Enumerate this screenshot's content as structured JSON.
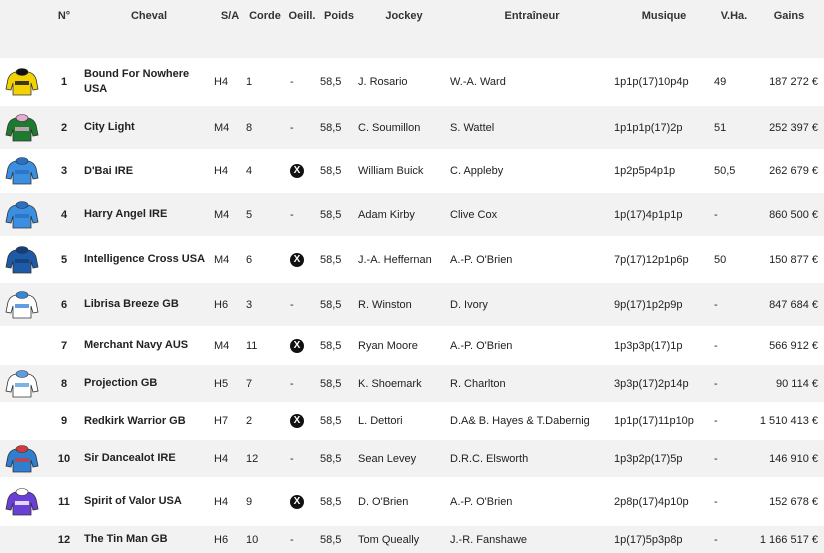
{
  "headers": {
    "num": "N°",
    "horse": "Cheval",
    "sa": "S/A",
    "corde": "Corde",
    "oeil": "Oeill.",
    "poids": "Poids",
    "jockey": "Jockey",
    "trainer": "Entraîneur",
    "musique": "Musique",
    "vha": "V.Ha.",
    "gains": "Gains"
  },
  "rows": [
    {
      "num": "1",
      "horse": "Bound For Nowhere USA",
      "sa": "H4",
      "corde": "1",
      "oeil": "-",
      "poids": "58,5",
      "jockey": "J. Rosario",
      "trainer": "W.-A. Ward",
      "musique": "1p1p(17)10p4p",
      "vha": "49",
      "gains": "187 272 €",
      "silk": "bound"
    },
    {
      "num": "2",
      "horse": "City Light",
      "sa": "M4",
      "corde": "8",
      "oeil": "-",
      "poids": "58,5",
      "jockey": "C. Soumillon",
      "trainer": "S. Wattel",
      "musique": "1p1p1p(17)2p",
      "vha": "51",
      "gains": "252 397 €",
      "silk": "city"
    },
    {
      "num": "3",
      "horse": "D'Bai IRE",
      "sa": "H4",
      "corde": "4",
      "oeil": "X",
      "poids": "58,5",
      "jockey": "William Buick",
      "trainer": "C. Appleby",
      "musique": "1p2p5p4p1p",
      "vha": "50,5",
      "gains": "262 679 €",
      "silk": "blue"
    },
    {
      "num": "4",
      "horse": "Harry Angel IRE",
      "sa": "M4",
      "corde": "5",
      "oeil": "-",
      "poids": "58,5",
      "jockey": "Adam Kirby",
      "trainer": "Clive Cox",
      "musique": "1p(17)4p1p1p",
      "vha": "-",
      "gains": "860 500 €",
      "silk": "blue"
    },
    {
      "num": "5",
      "horse": "Intelligence Cross USA",
      "sa": "M4",
      "corde": "6",
      "oeil": "X",
      "poids": "58,5",
      "jockey": "J.-A. Heffernan",
      "trainer": "A.-P. O'Brien",
      "musique": "7p(17)12p1p6p",
      "vha": "50",
      "gains": "150 877 €",
      "silk": "navy"
    },
    {
      "num": "6",
      "horse": "Librisa Breeze GB",
      "sa": "H6",
      "corde": "3",
      "oeil": "-",
      "poids": "58,5",
      "jockey": "R. Winston",
      "trainer": "D. Ivory",
      "musique": "9p(17)1p2p9p",
      "vha": "-",
      "gains": "847 684 €",
      "silk": "stripe"
    },
    {
      "num": "7",
      "horse": "Merchant Navy AUS",
      "sa": "M4",
      "corde": "11",
      "oeil": "X",
      "poids": "58,5",
      "jockey": "Ryan Moore",
      "trainer": "A.-P. O'Brien",
      "musique": "1p3p3p(17)1p",
      "vha": "-",
      "gains": "566 912 €",
      "silk": "none"
    },
    {
      "num": "8",
      "horse": "Projection GB",
      "sa": "H5",
      "corde": "7",
      "oeil": "-",
      "poids": "58,5",
      "jockey": "K. Shoemark",
      "trainer": "R. Charlton",
      "musique": "3p3p(17)2p14p",
      "vha": "-",
      "gains": "90 114 €",
      "silk": "white"
    },
    {
      "num": "9",
      "horse": "Redkirk Warrior GB",
      "sa": "H7",
      "corde": "2",
      "oeil": "X",
      "poids": "58,5",
      "jockey": "L. Dettori",
      "trainer": "D.A& B. Hayes & T.Dabernig",
      "musique": "1p1p(17)11p10p",
      "vha": "-",
      "gains": "1 510 413 €",
      "silk": "none"
    },
    {
      "num": "10",
      "horse": "Sir Dancealot IRE",
      "sa": "H4",
      "corde": "12",
      "oeil": "-",
      "poids": "58,5",
      "jockey": "Sean Levey",
      "trainer": "D.R.C. Elsworth",
      "musique": "1p3p2p(17)5p",
      "vha": "-",
      "gains": "146 910 €",
      "silk": "redv"
    },
    {
      "num": "11",
      "horse": "Spirit of Valor USA",
      "sa": "H4",
      "corde": "9",
      "oeil": "X",
      "poids": "58,5",
      "jockey": "D. O'Brien",
      "trainer": "A.-P. O'Brien",
      "musique": "2p8p(17)4p10p",
      "vha": "-",
      "gains": "152 678 €",
      "silk": "purple"
    },
    {
      "num": "12",
      "horse": "The Tin Man GB",
      "sa": "H6",
      "corde": "10",
      "oeil": "-",
      "poids": "58,5",
      "jockey": "Tom Queally",
      "trainer": "J.-R. Fanshawe",
      "musique": "1p(17)5p3p8p",
      "vha": "-",
      "gains": "1 166 517 €",
      "silk": "none"
    }
  ],
  "silk_colors": {
    "bound": [
      "#f2d200",
      "#111111"
    ],
    "city": [
      "#1e7a2e",
      "#e7a9d3"
    ],
    "blue": [
      "#3b8fe0",
      "#2a6fc0"
    ],
    "navy": [
      "#1d5aa8",
      "#143f7a"
    ],
    "stripe": [
      "#ffffff",
      "#3a86d8"
    ],
    "white": [
      "#ffffff",
      "#5aa0e0"
    ],
    "redv": [
      "#2e7fd0",
      "#d23b3b"
    ],
    "purple": [
      "#6a3fd6",
      "#ffffff"
    ]
  }
}
